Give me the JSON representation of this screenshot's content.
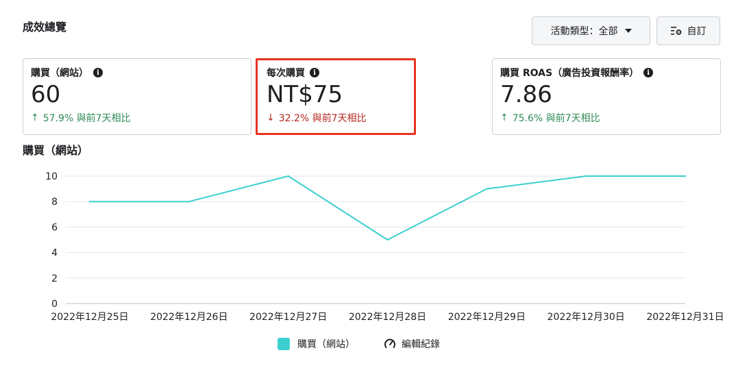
{
  "section_title": "成效總覽",
  "toolbar": {
    "dropdown_label": "活動類型：全部",
    "custom_label": "自訂"
  },
  "cards": [
    {
      "label": "購買（網站）",
      "value": "60",
      "change": "57.9% 與前7天相比",
      "direction": "up"
    },
    {
      "label": "每次購買",
      "value": "NT$75",
      "change": "32.2% 與前7天相比",
      "direction": "down"
    },
    {
      "label": "購買 ROAS（廣告投資報酬率）",
      "value": "7.86",
      "change": "75.6% 與前7天相比",
      "direction": "up"
    }
  ],
  "icons": {
    "info": "info-icon",
    "dropdown": "caret-down-icon",
    "custom": "settings-list-icon",
    "edit_history": "gauge-icon",
    "up": "arrow-up-icon",
    "down": "arrow-down-icon"
  },
  "colors": {
    "line": "#3ccfcf",
    "up": "#2e8b57",
    "down": "#b5261e",
    "highlight": "#e8321f"
  },
  "chart_title": "購買（網站）",
  "chart_data": {
    "type": "line",
    "categories": [
      "2022年12月25日",
      "2022年12月26日",
      "2022年12月27日",
      "2022年12月28日",
      "2022年12月29日",
      "2022年12月30日",
      "2022年12月31日"
    ],
    "series": [
      {
        "name": "購買（網站）",
        "values": [
          8,
          8,
          10,
          5,
          9,
          10,
          10
        ]
      }
    ],
    "yticks": [
      0,
      2,
      4,
      6,
      8,
      10
    ],
    "ylim": [
      0,
      10
    ],
    "grid": true,
    "legend": "bottom"
  },
  "legend": {
    "series_label": "購買（網站）",
    "edit_label": "編輯紀錄"
  }
}
